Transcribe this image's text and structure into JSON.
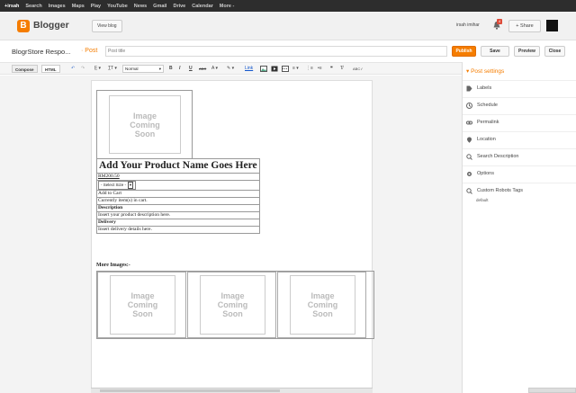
{
  "gbar": {
    "items": [
      "+irsah",
      "Search",
      "Images",
      "Maps",
      "Play",
      "YouTube",
      "News",
      "Gmail",
      "Drive",
      "Calendar",
      "More -"
    ]
  },
  "header": {
    "brand": "Blogger",
    "logo_letter": "B",
    "view_blog": "View blog",
    "user": "irsah imihar",
    "notif_count": "4",
    "share": "+ Share"
  },
  "titlerow": {
    "blog_title": "BlogrStore Respo...",
    "crumb": "· Post",
    "post_title_placeholder": "Post title",
    "publish": "Publish",
    "save": "Save",
    "preview": "Preview",
    "close": "Close"
  },
  "toolbar": {
    "compose": "Compose",
    "html": "HTML",
    "undo": "↶",
    "redo": "↷",
    "font": "F̲ ▾",
    "size": "T̲T ▾",
    "format": "Normal",
    "bold": "B",
    "italic": "I",
    "underline": "U",
    "strike": "ABC",
    "textcolor": "A ▾",
    "highlight": "✎ ▾",
    "link": "Link",
    "align": "≡ ▾",
    "numlist": "⋮≡",
    "bullist": "•≡",
    "quote": "❝",
    "clear": "T̸",
    "spell": "ABC✓"
  },
  "colors": {
    "accent": "#f57d00",
    "gbar": "#2d2d2d",
    "link": "#1155cc"
  },
  "editor": {
    "image_placeholder": "Image\nComing\nSoon",
    "product_name": "Add Your Product Name Goes Here 1",
    "price": "RM200.50",
    "size_select": "- Select Size -",
    "add_to_cart": "Add to Cart",
    "cart_status": "Currently item(s) in cart.",
    "description_label": "Description",
    "description_text": "Insert your product description here.",
    "delivery_label": "Delivery",
    "delivery_text": "Insert delivery details here.",
    "more_images": "More Images:-"
  },
  "sidebar": {
    "title": "▾ Post settings",
    "items": [
      {
        "label": "Labels",
        "icon": "label-icon"
      },
      {
        "label": "Schedule",
        "icon": "clock-icon"
      },
      {
        "label": "Permalink",
        "icon": "link-icon"
      },
      {
        "label": "Location",
        "icon": "pin-icon"
      },
      {
        "label": "Search Description",
        "icon": "search-icon"
      },
      {
        "label": "Options",
        "icon": "gear-icon"
      },
      {
        "label": "Custom Robots Tags",
        "icon": "search-icon"
      }
    ],
    "robots_value": "default"
  }
}
